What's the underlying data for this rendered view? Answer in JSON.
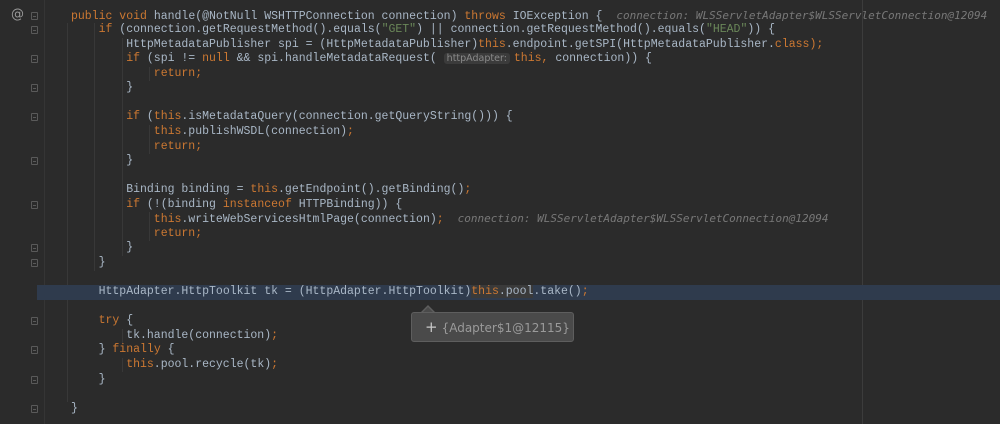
{
  "gutter": {
    "override_marker": "@"
  },
  "highlighted_line": 19,
  "fold_lines": [
    0,
    1,
    3,
    5,
    7,
    10,
    13,
    16,
    17,
    21,
    23,
    25,
    27
  ],
  "lines": [
    {
      "indent": 0,
      "tokens": [
        {
          "t": "public void",
          "c": "k"
        },
        {
          "t": " handle(@NotNull WSHTTPConnection connection) ",
          "c": ""
        },
        {
          "t": "throws",
          "c": "k"
        },
        {
          "t": " IOException {",
          "c": ""
        },
        {
          "t": "connection: WLSServletAdapter$WLSServletConnection@12094",
          "c": "h"
        }
      ]
    },
    {
      "indent": 1,
      "tokens": [
        {
          "t": "if",
          "c": "k"
        },
        {
          "t": " (connection.getRequestMethod().equals(",
          "c": ""
        },
        {
          "t": "\"GET\"",
          "c": "s"
        },
        {
          "t": ") || connection.getRequestMethod().equals(",
          "c": ""
        },
        {
          "t": "\"HEAD\"",
          "c": "s"
        },
        {
          "t": ")) {",
          "c": ""
        }
      ]
    },
    {
      "indent": 2,
      "tokens": [
        {
          "t": "HttpMetadataPublisher spi = (HttpMetadataPublisher)",
          "c": ""
        },
        {
          "t": "this",
          "c": "k"
        },
        {
          "t": ".endpoint.getSPI(HttpMetadataPublisher.",
          "c": ""
        },
        {
          "t": "class",
          "c": "k"
        },
        {
          "t": ");",
          "c": "k"
        }
      ]
    },
    {
      "indent": 2,
      "tokens": [
        {
          "t": "if",
          "c": "k"
        },
        {
          "t": " (spi != ",
          "c": ""
        },
        {
          "t": "null",
          "c": "k"
        },
        {
          "t": " && spi.handleMetadataRequest( ",
          "c": ""
        },
        {
          "t": "httpAdapter:",
          "c": "pill"
        },
        {
          "t": "this,",
          "c": "k"
        },
        {
          "t": " connection)) {",
          "c": ""
        }
      ]
    },
    {
      "indent": 3,
      "tokens": [
        {
          "t": "return;",
          "c": "k"
        }
      ]
    },
    {
      "indent": 2,
      "tokens": [
        {
          "t": "}",
          "c": ""
        }
      ]
    },
    {
      "indent": 0,
      "tokens": []
    },
    {
      "indent": 2,
      "tokens": [
        {
          "t": "if",
          "c": "k"
        },
        {
          "t": " (",
          "c": ""
        },
        {
          "t": "this",
          "c": "k"
        },
        {
          "t": ".isMetadataQuery(connection.getQueryString())) {",
          "c": ""
        }
      ]
    },
    {
      "indent": 3,
      "tokens": [
        {
          "t": "this",
          "c": "k"
        },
        {
          "t": ".publishWSDL(connection)",
          "c": ""
        },
        {
          "t": ";",
          "c": "k"
        }
      ]
    },
    {
      "indent": 3,
      "tokens": [
        {
          "t": "return;",
          "c": "k"
        }
      ]
    },
    {
      "indent": 2,
      "tokens": [
        {
          "t": "}",
          "c": ""
        }
      ]
    },
    {
      "indent": 0,
      "tokens": []
    },
    {
      "indent": 2,
      "tokens": [
        {
          "t": "Binding binding = ",
          "c": ""
        },
        {
          "t": "this",
          "c": "k"
        },
        {
          "t": ".getEndpoint().getBinding()",
          "c": ""
        },
        {
          "t": ";",
          "c": "k"
        }
      ]
    },
    {
      "indent": 2,
      "tokens": [
        {
          "t": "if",
          "c": "k"
        },
        {
          "t": " (!(binding ",
          "c": ""
        },
        {
          "t": "instanceof",
          "c": "k"
        },
        {
          "t": " HTTPBinding)) {",
          "c": ""
        }
      ]
    },
    {
      "indent": 3,
      "tokens": [
        {
          "t": "this",
          "c": "k"
        },
        {
          "t": ".writeWebServicesHtmlPage(connection)",
          "c": ""
        },
        {
          "t": ";",
          "c": "k"
        },
        {
          "t": "connection: WLSServletAdapter$WLSServletConnection@12094",
          "c": "h"
        }
      ]
    },
    {
      "indent": 3,
      "tokens": [
        {
          "t": "return;",
          "c": "k"
        }
      ]
    },
    {
      "indent": 2,
      "tokens": [
        {
          "t": "}",
          "c": ""
        }
      ]
    },
    {
      "indent": 1,
      "tokens": [
        {
          "t": "}",
          "c": ""
        }
      ]
    },
    {
      "indent": 0,
      "tokens": []
    },
    {
      "indent": 1,
      "tokens": [
        {
          "t": "HttpAdapter.HttpToolkit tk = (HttpAdapter.HttpToolkit)",
          "c": ""
        },
        {
          "t": "this",
          "c": "k sel"
        },
        {
          "t": ".pool",
          "c": "sel"
        },
        {
          "t": ".take()",
          "c": ""
        },
        {
          "t": ";",
          "c": "k"
        }
      ]
    },
    {
      "indent": 0,
      "tokens": []
    },
    {
      "indent": 1,
      "tokens": [
        {
          "t": "try",
          "c": "k"
        },
        {
          "t": " {",
          "c": ""
        }
      ]
    },
    {
      "indent": 2,
      "tokens": [
        {
          "t": "tk.handle(connection)",
          "c": ""
        },
        {
          "t": ";",
          "c": "k"
        }
      ]
    },
    {
      "indent": 1,
      "tokens": [
        {
          "t": "} ",
          "c": ""
        },
        {
          "t": "finally",
          "c": "k"
        },
        {
          "t": " {",
          "c": ""
        }
      ]
    },
    {
      "indent": 2,
      "tokens": [
        {
          "t": "this",
          "c": "k"
        },
        {
          "t": ".pool.recycle(tk)",
          "c": ""
        },
        {
          "t": ";",
          "c": "k"
        }
      ]
    },
    {
      "indent": 1,
      "tokens": [
        {
          "t": "}",
          "c": ""
        }
      ]
    },
    {
      "indent": 0,
      "tokens": []
    },
    {
      "indent": 0,
      "tokens": [
        {
          "t": "}",
          "c": ""
        }
      ]
    }
  ],
  "tooltip": {
    "expand_icon": "+",
    "value": "{Adapter$1@12115}"
  }
}
